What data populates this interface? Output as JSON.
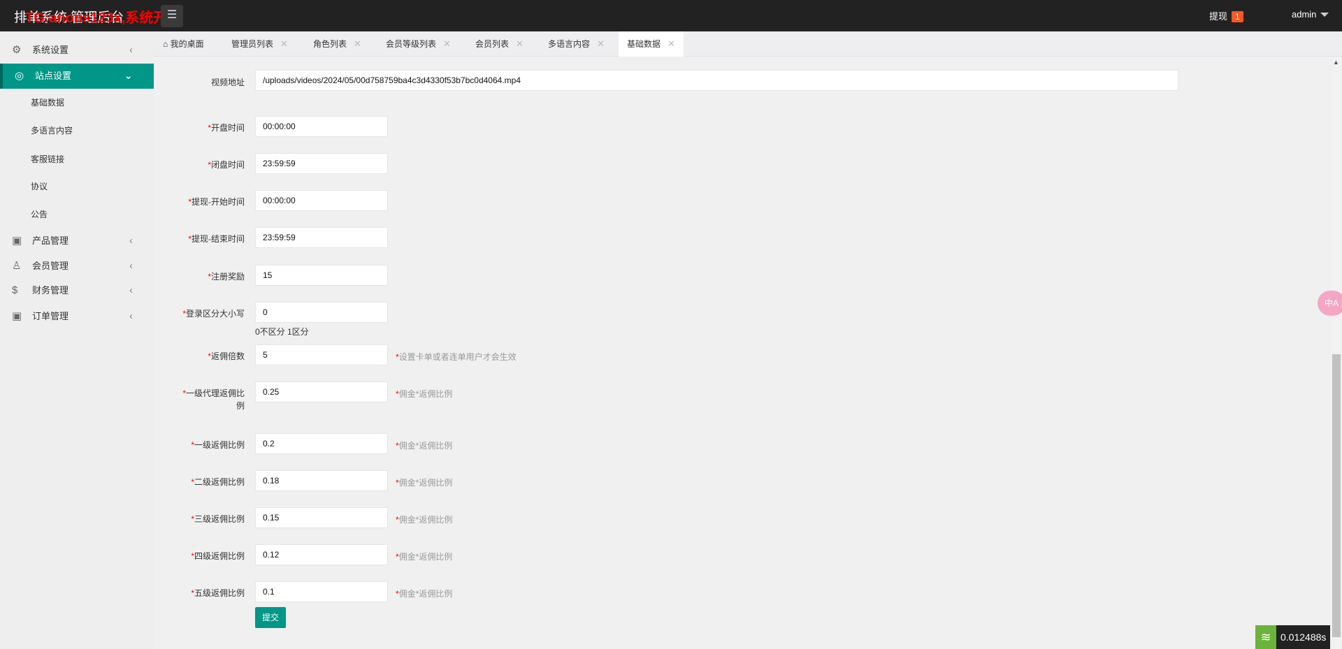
{
  "header": {
    "title": "排单系统 管理后台",
    "watermark": "TG:anons123x,系统开发",
    "menu_toggle_icon": "menu-icon",
    "withdraw_label": "提现",
    "withdraw_count": "1",
    "user": "admin"
  },
  "sidebar": {
    "items": [
      {
        "label": "系统设置",
        "icon": "gear-icon"
      },
      {
        "label": "站点设置",
        "icon": "site-icon",
        "active": true,
        "children": [
          "基础数据",
          "多语言内容",
          "客服链接",
          "协议",
          "公告"
        ]
      },
      {
        "label": "产品管理",
        "icon": "box-icon"
      },
      {
        "label": "会员管理",
        "icon": "user-icon"
      },
      {
        "label": "财务管理",
        "icon": "dollar-icon"
      },
      {
        "label": "订单管理",
        "icon": "box-icon"
      }
    ]
  },
  "tabs": [
    {
      "label": "我的桌面",
      "icon": "home-icon"
    },
    {
      "label": "管理员列表"
    },
    {
      "label": "角色列表"
    },
    {
      "label": "会员等级列表"
    },
    {
      "label": "会员列表"
    },
    {
      "label": "多语言内容"
    },
    {
      "label": "基础数据",
      "active": true
    }
  ],
  "tab_close": "✕",
  "form": {
    "video": {
      "label": "视频地址",
      "value": "/uploads/videos/2024/05/00d758759ba4c3d4330f53b7bc0d4064.mp4"
    },
    "fields": [
      {
        "label": "开盘时间",
        "value": "00:00:00"
      },
      {
        "label": "闭盘时间",
        "value": "23:59:59"
      },
      {
        "label": "提现-开始时间",
        "value": "00:00:00"
      },
      {
        "label": "提现-结束时间",
        "value": "23:59:59"
      },
      {
        "label": "注册奖励",
        "value": "15"
      },
      {
        "label": "登录区分大小写",
        "value": "0",
        "note": "0不区分 1区分"
      },
      {
        "label": "返佣倍数",
        "value": "5",
        "hint": "设置卡单或者连单用户才会生效"
      },
      {
        "label": "一级代理返佣比例",
        "value": "0.25",
        "hint": "佣金*返佣比例"
      },
      {
        "label": "一级返佣比例",
        "value": "0.2",
        "hint": "佣金*返佣比例"
      },
      {
        "label": "二级返佣比例",
        "value": "0.18",
        "hint": "佣金*返佣比例"
      },
      {
        "label": "三级返佣比例",
        "value": "0.15",
        "hint": "佣金*返佣比例"
      },
      {
        "label": "四级返佣比例",
        "value": "0.12",
        "hint": "佣金*返佣比例"
      },
      {
        "label": "五级返佣比例",
        "value": "0.1",
        "hint": "佣金*返佣比例"
      }
    ],
    "required_mark": "*",
    "submit": "提交"
  },
  "widgets": {
    "translate_icon": "translate-icon",
    "translate_glyph": "中A",
    "timer": "0.012488s"
  },
  "colors": {
    "primary": "#009688",
    "header": "#222222",
    "badge": "#ff5722"
  }
}
